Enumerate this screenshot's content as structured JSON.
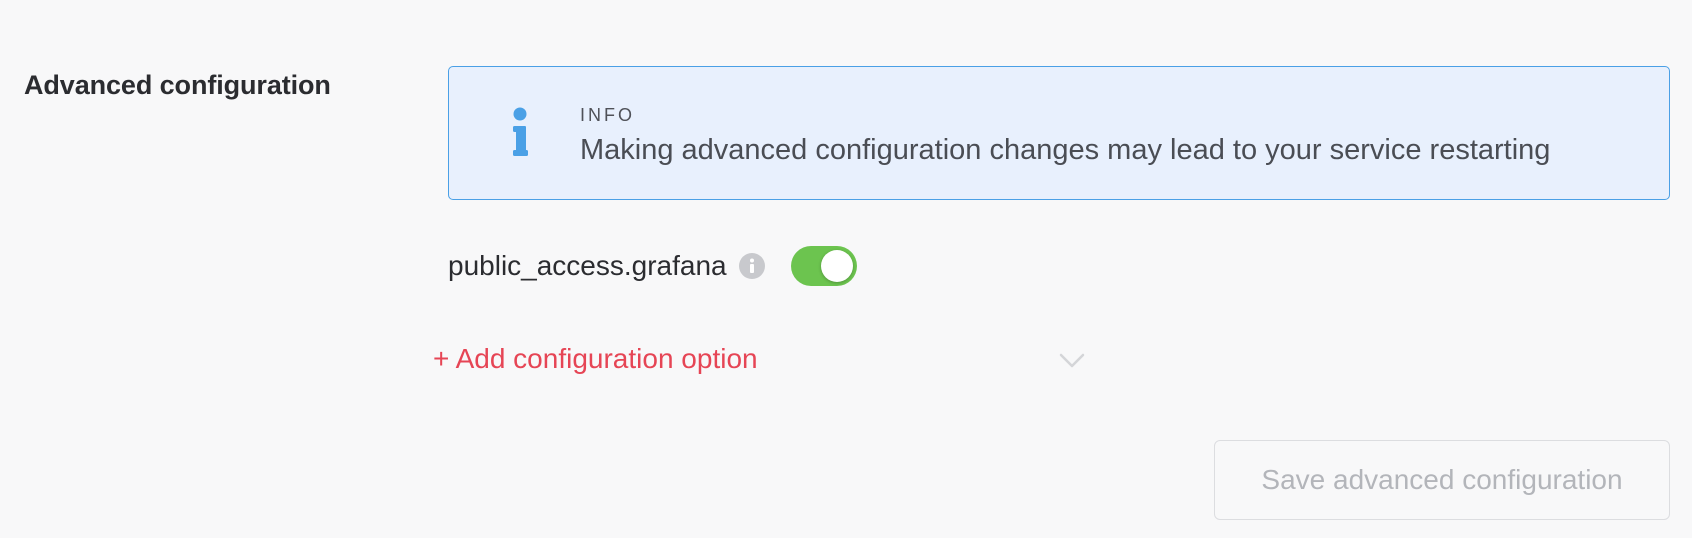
{
  "section": {
    "title": "Advanced configuration"
  },
  "info_banner": {
    "icon": "info-icon",
    "heading": "INFO",
    "message": "Making advanced configuration changes may lead to your service restarting",
    "accent_color": "#4aa0e6",
    "background_color": "#e8f0fd"
  },
  "options": [
    {
      "key": "public_access.grafana",
      "help_icon": "info-circle-icon",
      "enabled": true,
      "toggle_color": "#6cc44f"
    }
  ],
  "add_option": {
    "label": "+ Add configuration option",
    "chevron_icon": "chevron-down-icon",
    "color": "#e64555"
  },
  "save_button": {
    "label": "Save advanced configuration",
    "disabled": true
  }
}
